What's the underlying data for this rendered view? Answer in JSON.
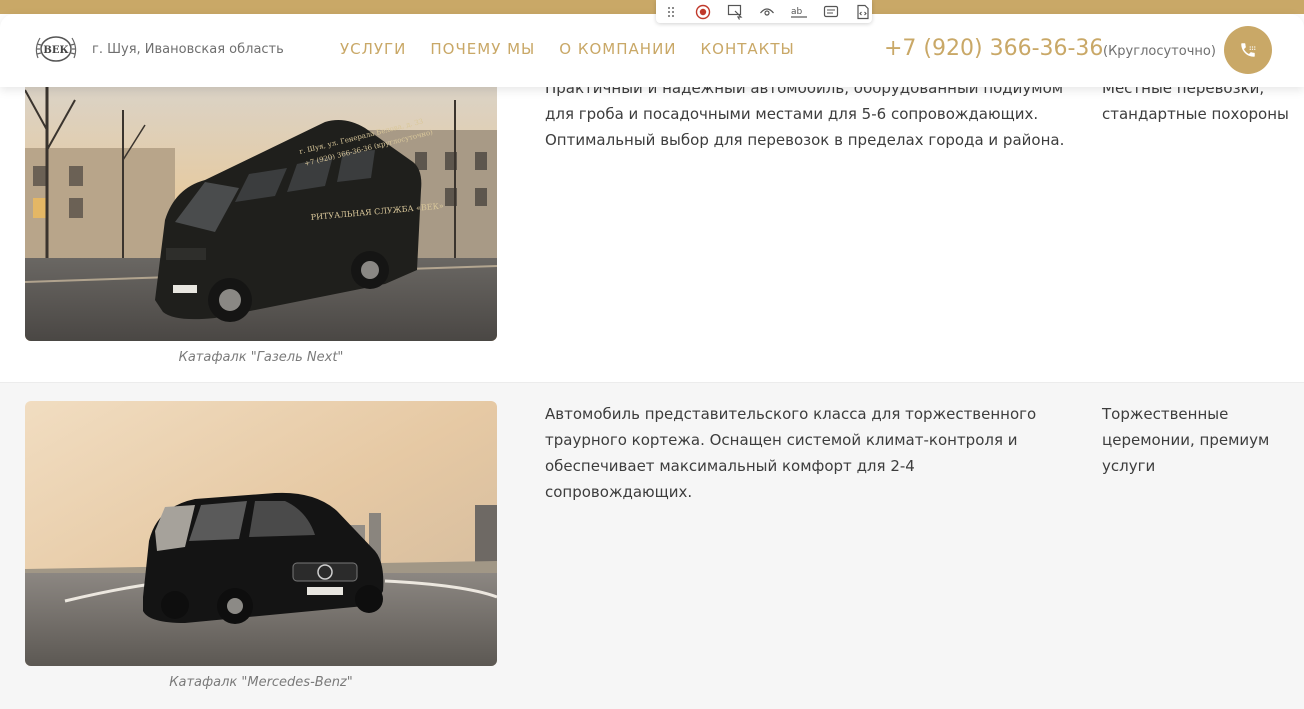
{
  "header": {
    "logo_text": "ВЕК",
    "region": "г. Шуя, Ивановская область",
    "nav": [
      "УСЛУГИ",
      "ПОЧЕМУ МЫ",
      "О КОМПАНИИ",
      "КОНТАКТЫ"
    ],
    "phone": "+7 (920) 366-36-36",
    "hours": "(Круглосуточно)",
    "call_icon": "phone-icon"
  },
  "toolbar": {
    "icons": [
      "drag-handle-icon",
      "record-icon",
      "select-element-icon",
      "eye-icon",
      "text-field-icon",
      "comment-icon",
      "code-icon"
    ]
  },
  "vehicles": [
    {
      "description": "Практичный и надежный автомобиль, оборудованный подиумом для гроба и посадочными местами для 5-6 сопровождающих. Оптимальный выбор для перевозок в пределах города и района.",
      "use": "Местные перевозки, стандартные похороны",
      "caption": "Катафалк \"Газель Next\"",
      "van_lettering": [
        "г. Шуя, ул. Генерала Белова, д. 33",
        "+7 (920) 366-36-36 (круглосуточно)",
        "РИТУАЛЬНАЯ СЛУЖБА «ВЕК»"
      ]
    },
    {
      "description": "Автомобиль представительского класса для торжественного траурного кортежа. Оснащен системой климат-контроля и обеспечивает максимальный комфорт для 2-4 сопровождающих.",
      "use": "Торжественные церемонии, премиум услуги",
      "caption": "Катафалк \"Mercedes-Benz\""
    }
  ],
  "colors": {
    "accent": "#c9a867",
    "text": "#3d3d3d",
    "muted": "#6f6f6f",
    "row_alt": "#f6f6f6"
  }
}
